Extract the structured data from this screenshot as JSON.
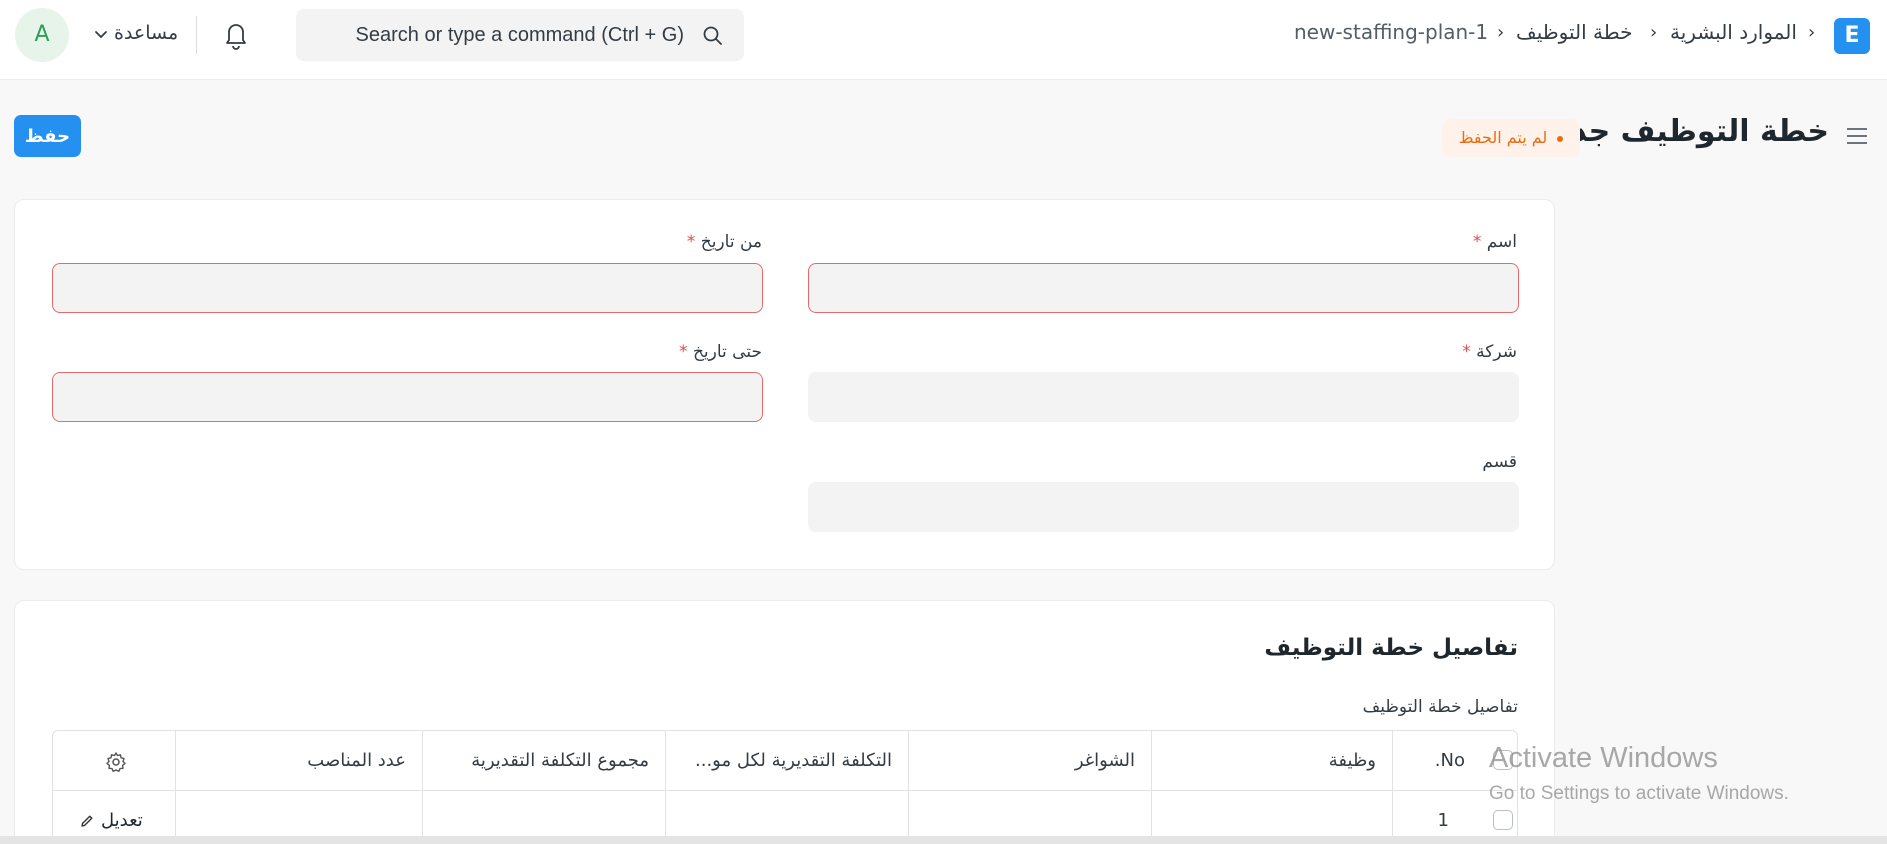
{
  "navbar": {
    "logo_letter": "E",
    "breadcrumbs": [
      "الموارد البشرية",
      "خطة التوظيف",
      "new-staffing-plan-1"
    ],
    "search_placeholder": "Search or type a command (Ctrl + G)",
    "help_label": "مساعدة",
    "avatar_letter": "A"
  },
  "page": {
    "title": "خطة التوظيف جديد",
    "status": "لم يتم الحفظ",
    "save_label": "حفظ"
  },
  "form": {
    "name_label": "اسم",
    "from_date_label": "من تاريخ",
    "company_label": "شركة",
    "to_date_label": "حتى تاريخ",
    "department_label": "قسم",
    "required_mark": "*"
  },
  "details": {
    "section_title": "تفاصيل خطة التوظيف",
    "table_label": "تفاصيل خطة التوظيف",
    "columns": {
      "no": "No.",
      "designation": "وظيفة",
      "vacancies": "الشواغر",
      "estimated_cost": "التكلفة التقديرية لكل مو...",
      "total_estimated_cost": "مجموع التكلفة التقديرية",
      "number_of_positions": "عدد المناصب"
    },
    "rows": [
      {
        "no": "1",
        "edit_label": "تعديل"
      }
    ]
  },
  "watermark": {
    "title": "Activate Windows",
    "subtitle": "Go to Settings to activate Windows."
  },
  "colors": {
    "primary": "#2490ef",
    "warning": "#e86c13",
    "error_border": "#e46b6b"
  }
}
